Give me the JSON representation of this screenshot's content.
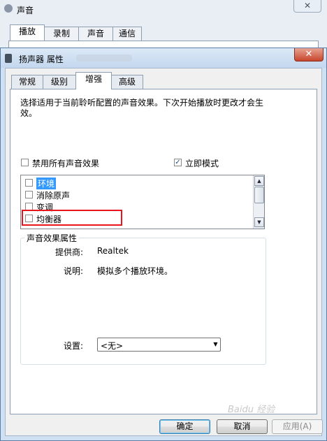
{
  "background_window": {
    "title": "声音",
    "close_glyph": "✕",
    "tabs": [
      "播放",
      "录制",
      "声音",
      "通信"
    ]
  },
  "dialog": {
    "title": "扬声器 属性",
    "close_glyph": "✕",
    "tabs": [
      "常规",
      "级别",
      "增强",
      "高级"
    ],
    "active_tab": "增强",
    "description": "选择适用于当前聆听配置的声音效果。下次开始播放时更改才会生效。",
    "disable_all_label": "禁用所有声音效果",
    "disable_all_checked": false,
    "immediate_mode_label": "立即模式",
    "immediate_mode_checked": true,
    "check_glyph": "✓",
    "effects": [
      {
        "label": "环境",
        "checked": false,
        "selected": true
      },
      {
        "label": "消除原声",
        "checked": false,
        "selected": false
      },
      {
        "label": "变调",
        "checked": false,
        "selected": false
      },
      {
        "label": "均衡器",
        "checked": false,
        "selected": false,
        "highlighted": true
      }
    ],
    "properties_group": {
      "title": "声音效果属性",
      "provider_label": "提供商:",
      "provider_value": "Realtek",
      "description_label": "说明:",
      "description_value": "模拟多个播放环境。",
      "settings_label": "设置:",
      "settings_value": "<无>"
    },
    "buttons": {
      "ok": "确定",
      "cancel": "取消",
      "apply": "应用(A)"
    }
  },
  "watermark": "Baidu 经验",
  "colors": {
    "highlight_box": "#e8151c",
    "selection": "#3399ff"
  }
}
